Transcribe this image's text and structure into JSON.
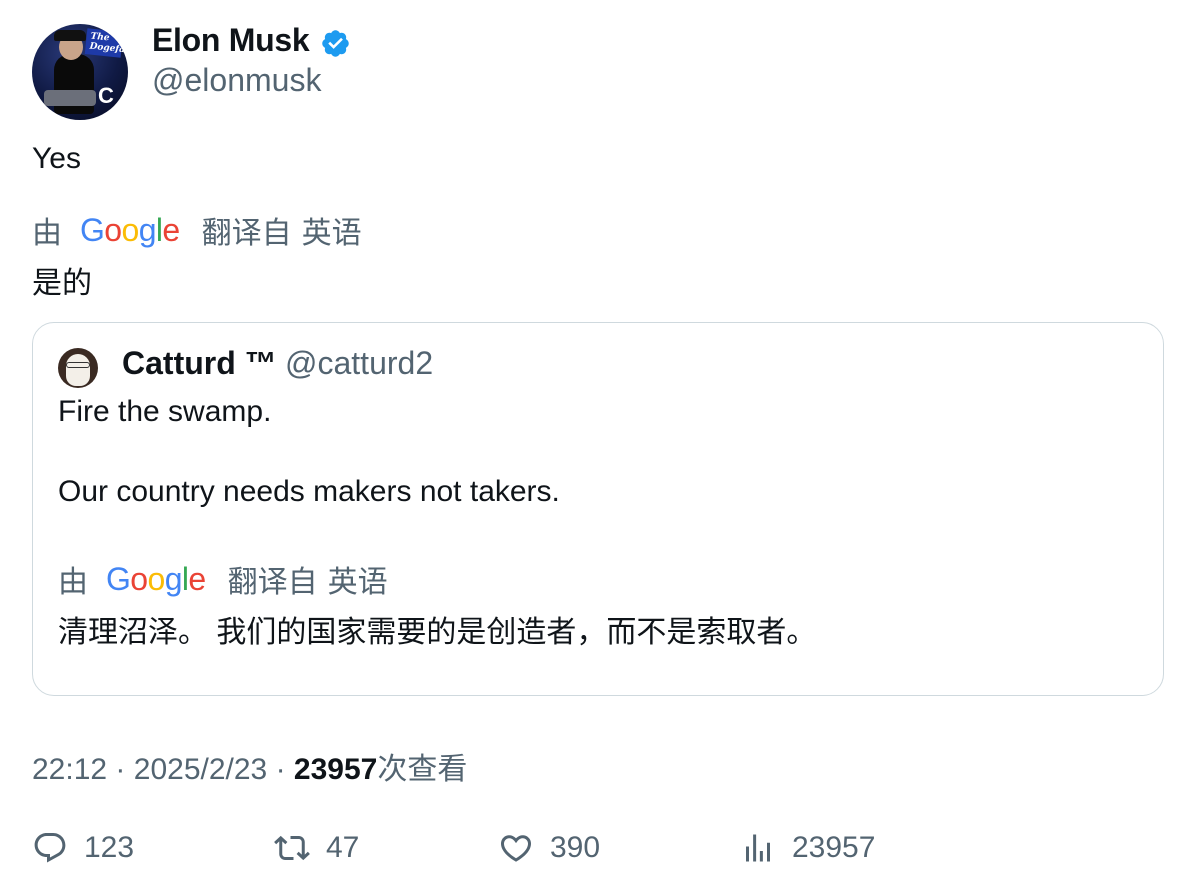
{
  "author": {
    "name": "Elon Musk",
    "handle": "@elonmusk",
    "avatar_sign_text": "The Dogefa"
  },
  "tweet": {
    "text": "Yes",
    "translation": {
      "by_label": "由",
      "provider": "Google",
      "from_label": "翻译自",
      "language": "英语",
      "text": "是的"
    }
  },
  "quote": {
    "name": "Catturd ™",
    "handle": "@catturd2",
    "line1": "Fire the swamp.",
    "line2": "Our country needs makers not takers.",
    "translation": {
      "by_label": "由",
      "provider": "Google",
      "from_label": "翻译自",
      "language": "英语",
      "text": "清理沼泽。 我们的国家需要的是创造者，而不是索取者。"
    }
  },
  "meta": {
    "time": "22:12",
    "sep": "·",
    "date": "2025/2/23",
    "views": "23957",
    "views_label": "次查看"
  },
  "actions": {
    "replies": "123",
    "retweets": "47",
    "likes": "390",
    "views": "23957"
  },
  "colors": {
    "text_primary": "#0f1419",
    "text_secondary": "#536471",
    "border": "#cfd9de",
    "verified": "#1d9bf0"
  },
  "icons": [
    "verified-badge-icon",
    "reply-icon",
    "retweet-icon",
    "like-icon",
    "views-icon"
  ]
}
